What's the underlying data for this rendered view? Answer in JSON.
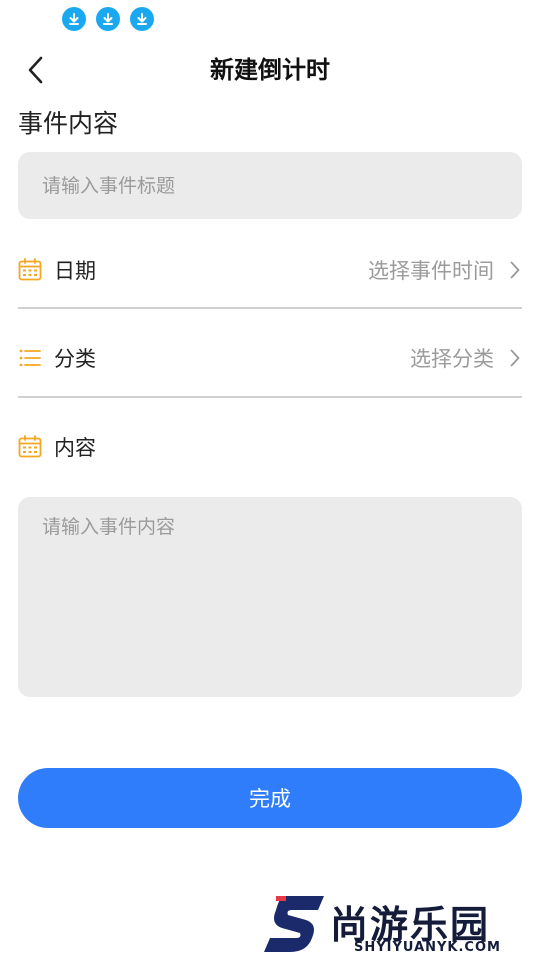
{
  "header": {
    "title": "新建倒计时"
  },
  "event_section": {
    "label": "事件内容",
    "title_placeholder": "请输入事件标题"
  },
  "date_row": {
    "label": "日期",
    "value": "选择事件时间"
  },
  "category_row": {
    "label": "分类",
    "value": "选择分类"
  },
  "content_row": {
    "label": "内容",
    "placeholder": "请输入事件内容"
  },
  "done_button": {
    "label": "完成"
  },
  "watermark": {
    "brand": "尚游乐园",
    "site": "SHYIYUANYK.COM"
  },
  "colors": {
    "accent_blue": "#2f7dfb",
    "icon_orange": "#f5a623",
    "field_bg": "#ebebeb",
    "status_icon": "#1aa9f0"
  },
  "icons": {
    "status": [
      "download-icon",
      "download-icon",
      "download-icon"
    ],
    "back": "chevron-left-icon",
    "date": "calendar-icon",
    "category": "list-icon",
    "content": "calendar-icon",
    "chevron": "chevron-right-icon"
  }
}
